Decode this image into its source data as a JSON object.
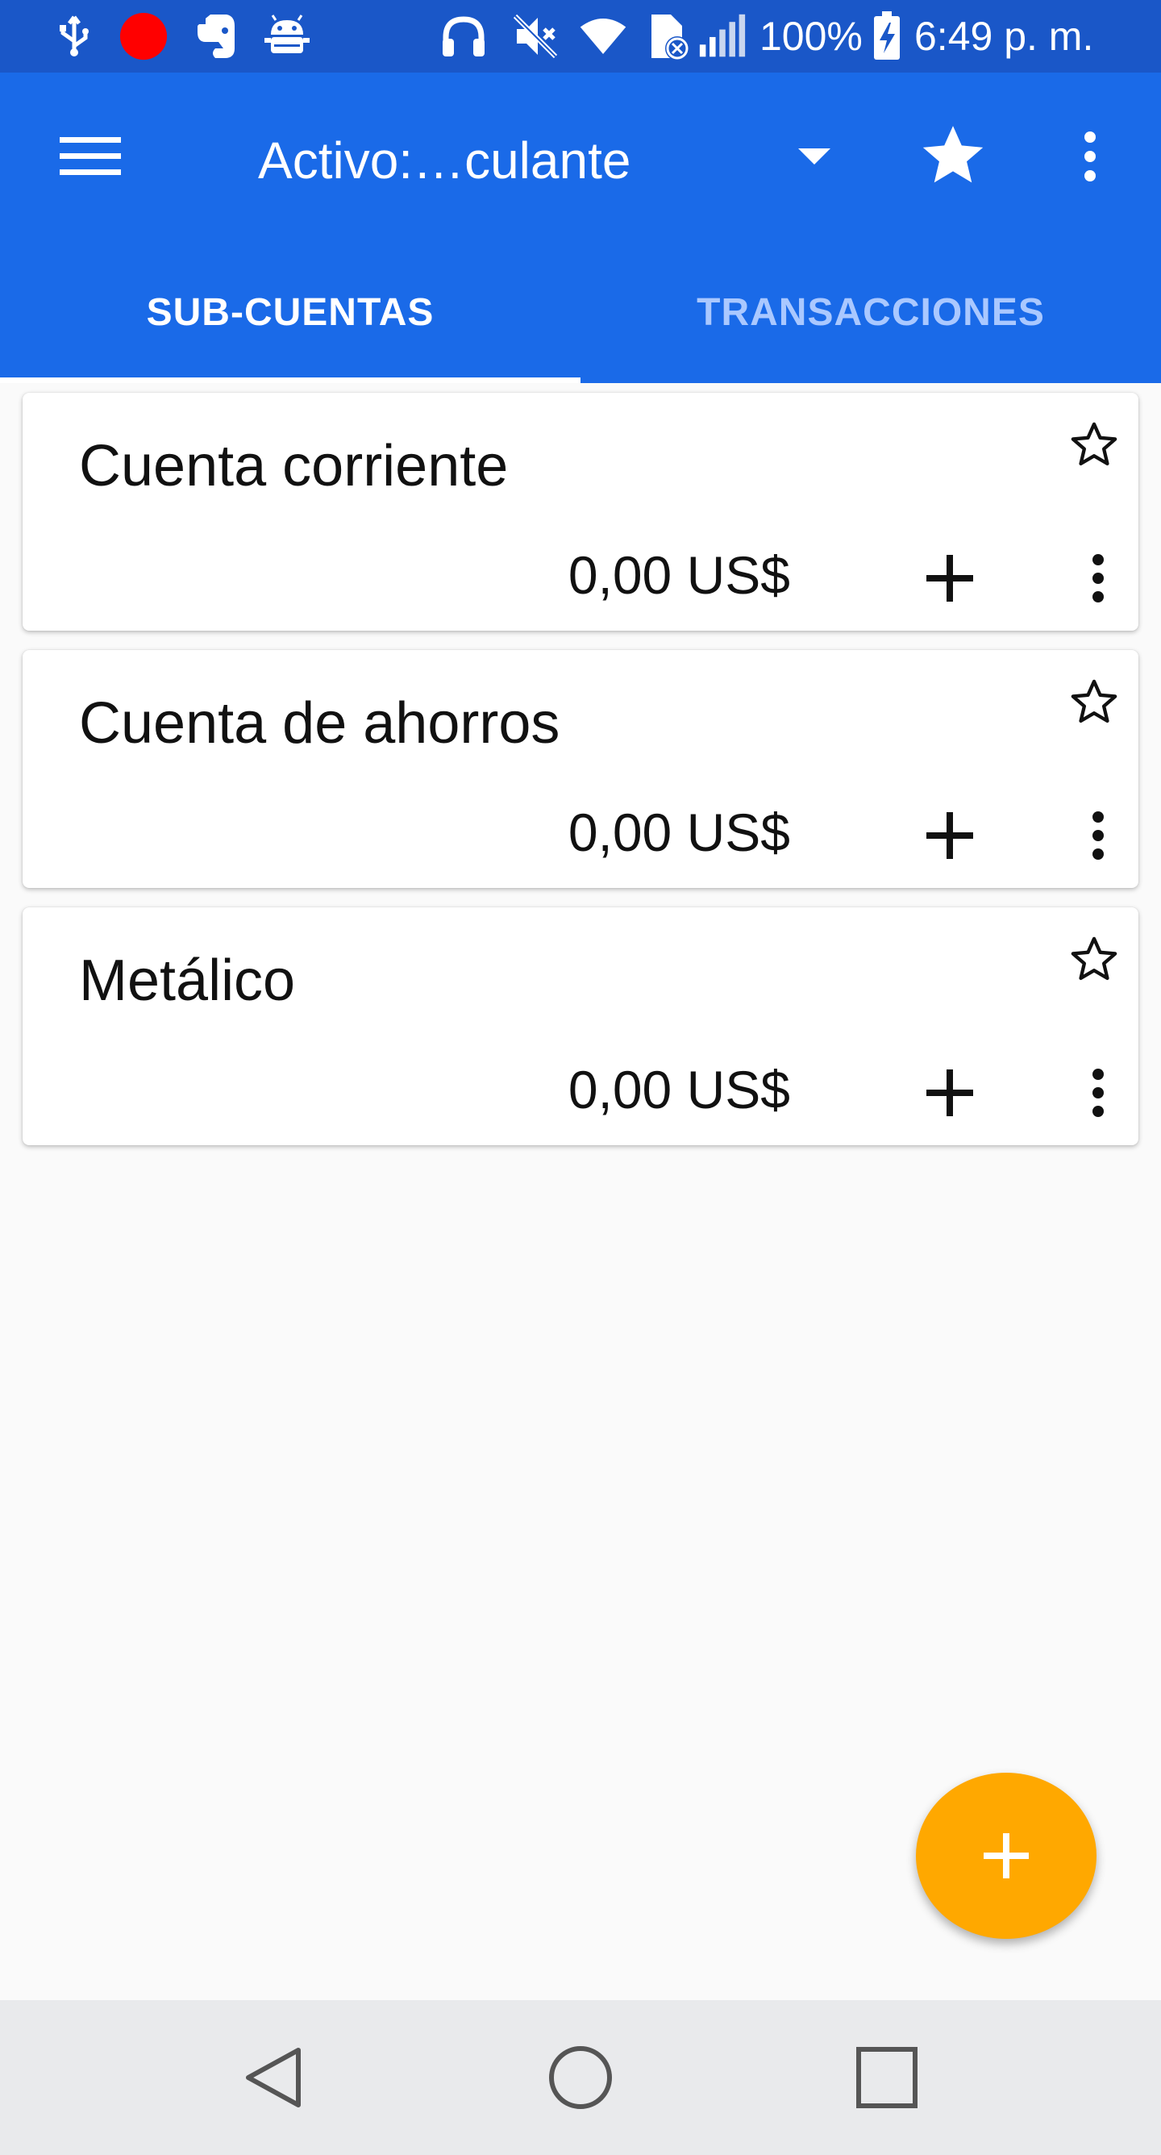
{
  "status_bar": {
    "battery": "100%",
    "time": "6:49 p. m.",
    "icons": [
      "usb-icon",
      "record-icon",
      "evernote-icon",
      "android-icon",
      "headphones-icon",
      "mute-icon",
      "wifi-icon",
      "sim-blocked-icon",
      "signal-icon",
      "battery-charging-icon"
    ],
    "record_color": "#ff0000"
  },
  "app_bar": {
    "menu_icon": "hamburger-menu-icon",
    "account_name": "Activo:…culante",
    "dropdown_icon": "dropdown-arrow-icon",
    "favorite_icon": "star-filled-icon",
    "overflow_icon": "more-vert-icon",
    "color": "#1a6ae8"
  },
  "tabs": [
    {
      "label": "SUB-CUENTAS",
      "active": true
    },
    {
      "label": "TRANSACCIONES",
      "active": false
    }
  ],
  "accounts": [
    {
      "name": "Cuenta corriente",
      "balance": "0,00 US$"
    },
    {
      "name": "Cuenta de ahorros",
      "balance": "0,00 US$"
    },
    {
      "name": "Metálico",
      "balance": "0,00 US$"
    }
  ],
  "fab": {
    "icon": "plus-icon",
    "color": "#ffa800"
  },
  "nav_bar": {
    "buttons": [
      "back-icon",
      "home-icon",
      "recents-icon"
    ]
  }
}
